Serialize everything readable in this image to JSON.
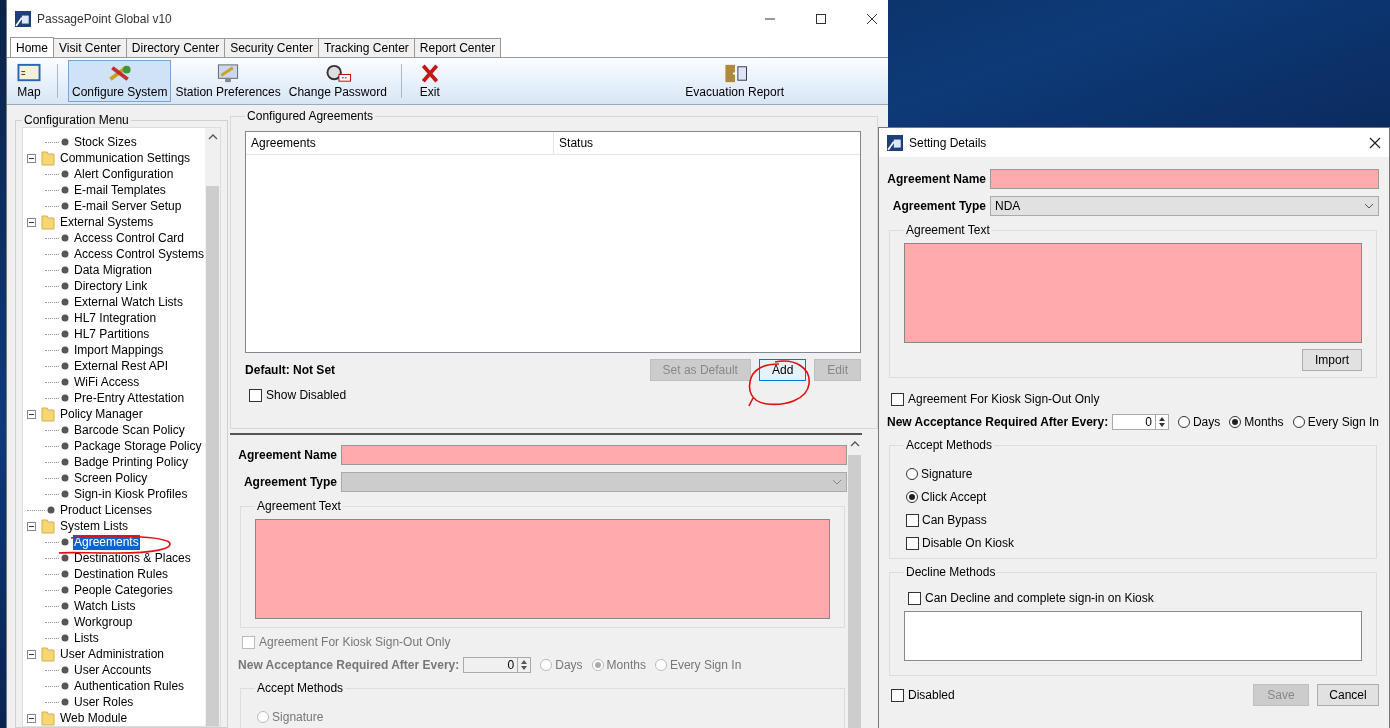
{
  "window": {
    "title": "PassagePoint Global v10"
  },
  "tabs": [
    {
      "label": "Home",
      "selected": true
    },
    {
      "label": "Visit Center",
      "selected": false
    },
    {
      "label": "Directory Center",
      "selected": false
    },
    {
      "label": "Security Center",
      "selected": false
    },
    {
      "label": "Tracking Center",
      "selected": false
    },
    {
      "label": "Report Center",
      "selected": false
    }
  ],
  "toolbar": [
    [
      {
        "label": "Map",
        "kind": "map",
        "selected": false
      }
    ],
    [
      {
        "label": "Configure System",
        "kind": "tools",
        "selected": true
      },
      {
        "label": "Station Preferences",
        "kind": "monitor",
        "selected": false
      },
      {
        "label": "Change Password",
        "kind": "password",
        "selected": false
      }
    ],
    [
      {
        "label": "Exit",
        "kind": "exit",
        "selected": false
      }
    ]
  ],
  "toolbar_right": [
    {
      "label": "Evacuation Report",
      "kind": "door",
      "selected": false
    }
  ],
  "configuration_menu": {
    "title": "Configuration Menu",
    "tree_continued": [
      {
        "label": "Stock Sizes",
        "selected": false
      }
    ],
    "tree": [
      {
        "label": "Communication Settings",
        "kind": "folder",
        "expanded": true,
        "children": [
          {
            "label": "Alert Configuration",
            "selected": false
          },
          {
            "label": "E-mail Templates",
            "selected": false
          },
          {
            "label": "E-mail Server Setup",
            "selected": false
          }
        ]
      },
      {
        "label": "External Systems",
        "kind": "folder",
        "expanded": true,
        "children": [
          {
            "label": "Access Control Card",
            "selected": false
          },
          {
            "label": "Access Control Systems",
            "selected": false
          },
          {
            "label": "Data Migration",
            "selected": false
          },
          {
            "label": "Directory Link",
            "selected": false
          },
          {
            "label": "External Watch Lists",
            "selected": false
          },
          {
            "label": "HL7 Integration",
            "selected": false
          },
          {
            "label": "HL7 Partitions",
            "selected": false
          },
          {
            "label": "Import Mappings",
            "selected": false
          },
          {
            "label": "External Rest API",
            "selected": false
          },
          {
            "label": "WiFi Access",
            "selected": false
          },
          {
            "label": "Pre-Entry Attestation",
            "selected": false
          }
        ]
      },
      {
        "label": "Policy Manager",
        "kind": "folder",
        "expanded": true,
        "children": [
          {
            "label": "Barcode Scan Policy",
            "selected": false
          },
          {
            "label": "Package Storage Policy",
            "selected": false
          },
          {
            "label": "Badge Printing Policy",
            "selected": false
          },
          {
            "label": "Screen Policy",
            "selected": false
          },
          {
            "label": "Sign-in Kiosk Profiles",
            "selected": false
          }
        ]
      },
      {
        "label": "Product Licenses",
        "kind": "leaf",
        "selected": false
      },
      {
        "label": "System Lists",
        "kind": "folder",
        "expanded": true,
        "children": [
          {
            "label": "Agreements",
            "selected": true
          },
          {
            "label": "Destinations & Places",
            "selected": false
          },
          {
            "label": "Destination Rules",
            "selected": false
          },
          {
            "label": "People Categories",
            "selected": false
          },
          {
            "label": "Watch Lists",
            "selected": false
          },
          {
            "label": "Workgroup",
            "selected": false
          },
          {
            "label": "Lists",
            "selected": false
          }
        ]
      },
      {
        "label": "User Administration",
        "kind": "folder",
        "expanded": true,
        "children": [
          {
            "label": "User Accounts",
            "selected": false
          },
          {
            "label": "Authentication Rules",
            "selected": false
          },
          {
            "label": "User Roles",
            "selected": false
          }
        ]
      },
      {
        "label": "Web Module",
        "kind": "folder",
        "expanded": true
      }
    ]
  },
  "configured_agreements": {
    "title": "Configured Agreements",
    "columns": [
      "Agreements",
      "Status"
    ],
    "default_label": "Default: Not Set",
    "buttons": [
      {
        "label": "Set as Default",
        "disabled": true
      },
      {
        "label": "Add",
        "disabled": false
      },
      {
        "label": "Edit",
        "disabled": true
      }
    ],
    "show_disabled": {
      "label": "Show Disabled",
      "checked": false
    }
  },
  "agreement_editor": {
    "disabled": true,
    "name_label": "Agreement Name",
    "type_label": "Agreement Type",
    "text_group": "Agreement Text",
    "kiosk_only": {
      "label": "Agreement For Kiosk Sign-Out Only",
      "checked": false
    },
    "renewal": {
      "label": "New Acceptance Required After Every:",
      "value": "0",
      "units": [
        {
          "label": "Days",
          "selected": false
        },
        {
          "label": "Months",
          "selected": true
        },
        {
          "label": "Every Sign In",
          "selected": false
        }
      ]
    },
    "accept_methods": {
      "title": "Accept Methods",
      "items": [
        {
          "kind": "radio",
          "label": "Signature",
          "selected": false
        }
      ]
    }
  },
  "setting_details": {
    "title": "Setting Details",
    "name_label": "Agreement Name",
    "type_label": "Agreement Type",
    "type_value": "NDA",
    "text_group": "Agreement Text",
    "import_button": "Import",
    "kiosk_only": {
      "label": "Agreement For Kiosk Sign-Out Only",
      "checked": false
    },
    "renewal": {
      "label": "New Acceptance Required After Every:",
      "value": "0",
      "units": [
        {
          "label": "Days",
          "selected": false
        },
        {
          "label": "Months",
          "selected": true
        },
        {
          "label": "Every Sign In",
          "selected": false
        }
      ]
    },
    "accept_methods": {
      "title": "Accept Methods",
      "items": [
        {
          "kind": "radio",
          "label": "Signature",
          "selected": false
        },
        {
          "kind": "radio",
          "label": "Click Accept",
          "selected": true
        },
        {
          "kind": "checkbox",
          "label": "Can Bypass",
          "checked": false
        },
        {
          "kind": "checkbox",
          "label": "Disable On Kiosk",
          "checked": false
        }
      ]
    },
    "decline_methods": {
      "title": "Decline Methods",
      "can_decline": {
        "label": "Can Decline and complete sign-in on Kiosk",
        "checked": false
      }
    },
    "disabled": {
      "label": "Disabled",
      "checked": false
    },
    "buttons": [
      {
        "label": "Save",
        "disabled": true
      },
      {
        "label": "Cancel",
        "disabled": false
      }
    ]
  }
}
